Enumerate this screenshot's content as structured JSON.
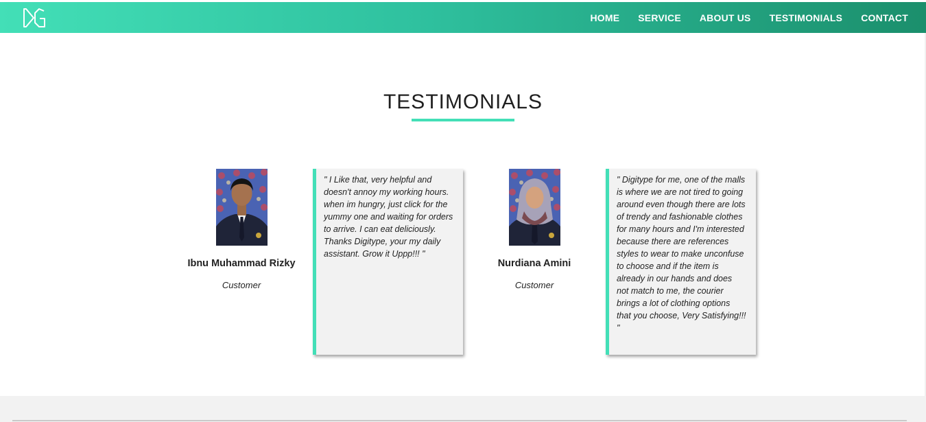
{
  "nav": {
    "logo_icon": "dg-logo-icon",
    "items": [
      {
        "label": "HOME"
      },
      {
        "label": "SERVICE"
      },
      {
        "label": "ABOUT US"
      },
      {
        "label": "TESTIMONIALS"
      },
      {
        "label": "CONTACT"
      }
    ]
  },
  "colors": {
    "accent": "#43dfb7",
    "nav_gradient_start": "#43dfb7",
    "nav_gradient_end": "#1b8f6c",
    "card_background": "#f2f2f2"
  },
  "section": {
    "title": "TESTIMONIALS"
  },
  "testimonials": [
    {
      "name": "Ibnu Muhammad Rizky",
      "role": "Customer",
      "quote": "\" I Like that, very helpful and doesn't annoy my working hours. when im hungry, just click for the yummy one and waiting for orders to arrive. I can eat deliciously. Thanks Digitype, your my daily assistant. Grow it Uppp!!! \""
    },
    {
      "name": "Nurdiana Amini",
      "role": "Customer",
      "quote": "\" Digitype for me, one of the malls is where we are not tired to going around even though there are lots of trendy and fashionable clothes for many hours and I'm interested because there are references styles to wear to make unconfuse to choose and if the item is already in our hands and does not match to me, the courier brings a lot of clothing options that you choose, Very Satisfying!!! \""
    }
  ]
}
